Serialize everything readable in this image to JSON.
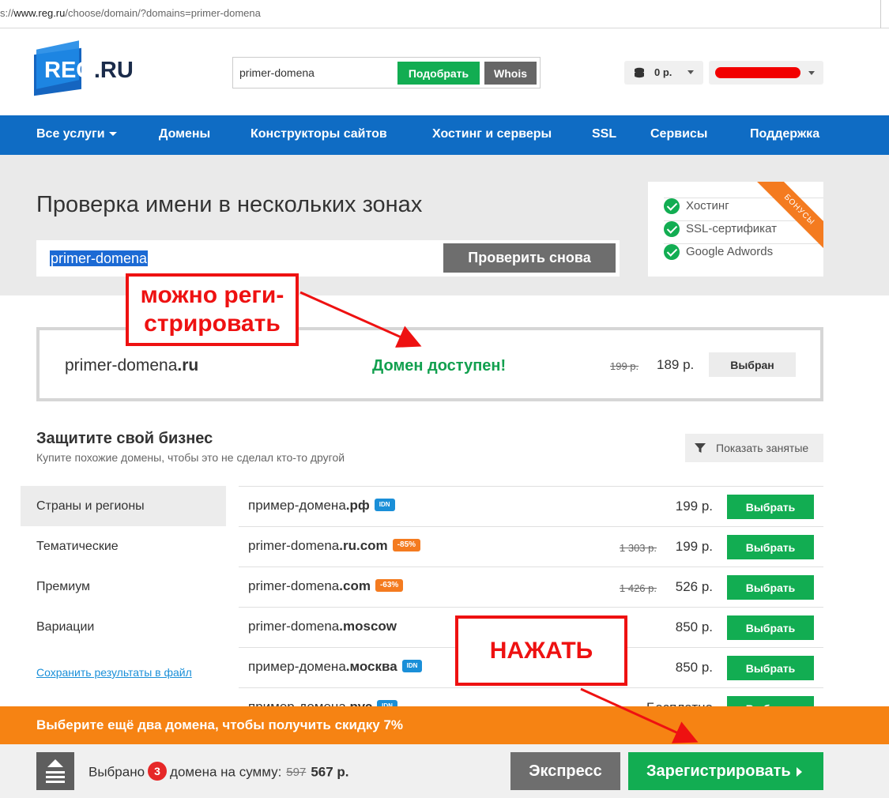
{
  "browser": {
    "url_prefix": "s://",
    "url_host": "www.reg.ru",
    "url_path": "/choose/domain/?domains=primer-domena"
  },
  "header": {
    "logo_text": "REG",
    "logo_dot": ".",
    "logo_ru": "RU",
    "search_value": "primer-domena",
    "pick_label": "Подобрать",
    "whois_label": "Whois",
    "balance": "0 р."
  },
  "nav": {
    "items": [
      "Все услуги",
      "Домены",
      "Конструкторы сайтов",
      "Хостинг и серверы",
      "SSL",
      "Сервисы",
      "Поддержка"
    ]
  },
  "hero": {
    "title": "Проверка имени в нескольких зонах",
    "query": "primer-domena",
    "recheck_label": "Проверить снова",
    "bonuses": [
      "Хостинг",
      "SSL-сертификат",
      "Google Adwords"
    ],
    "ribbon": "БОНУСЫ"
  },
  "annotations": {
    "register_line1": "можно реги-",
    "register_line2": "стрировать",
    "press": "НАЖАТЬ"
  },
  "result": {
    "name_prefix": "primer-domena",
    "name_zone": ".ru",
    "status": "Домен доступен!",
    "old_price": "199 р.",
    "price": "189 р.",
    "button": "Выбран"
  },
  "protect": {
    "title": "Защитите свой бизнес",
    "subtitle": "Купите похожие домены, чтобы это не сделал кто-то другой",
    "show_busy": "Показать занятые",
    "categories": [
      "Страны и регионы",
      "Тематические",
      "Премиум",
      "Вариации"
    ],
    "save_link": "Сохранить результаты в файл",
    "rows": [
      {
        "prefix": "пример-домена",
        "zone": ".рф",
        "tag": "IDN",
        "tag_type": "idn",
        "old": "",
        "price": "199 р.",
        "button": "Выбрать"
      },
      {
        "prefix": "primer-domena",
        "zone": ".ru.com",
        "tag": "-85%",
        "tag_type": "sale",
        "old": "1 303 р.",
        "price": "199 р.",
        "button": "Выбрать"
      },
      {
        "prefix": "primer-domena",
        "zone": ".com",
        "tag": "-63%",
        "tag_type": "sale",
        "old": "1 426 р.",
        "price": "526 р.",
        "button": "Выбрать"
      },
      {
        "prefix": "primer-domena",
        "zone": ".moscow",
        "tag": "",
        "tag_type": "",
        "old": "",
        "price": "850 р.",
        "button": "Выбрать"
      },
      {
        "prefix": "пример-домена",
        "zone": ".москва",
        "tag": "IDN",
        "tag_type": "idn",
        "old": "",
        "price": "850 р.",
        "button": "Выбрать"
      },
      {
        "prefix": "пример-домена",
        "zone": ".рус",
        "tag": "IDN",
        "tag_type": "idn",
        "old": "",
        "price": "Бесплатно",
        "button": "Выбрать"
      }
    ]
  },
  "footer": {
    "promo": "Выберите ещё два домена, чтобы получить скидку 7%",
    "selected_prefix": "Выбрано",
    "selected_count": "3",
    "selected_suffix": "домена на сумму:",
    "old_sum": "597",
    "sum": "567 р.",
    "express": "Экспресс",
    "register": "Зарегистрировать"
  },
  "colors": {
    "nav_blue": "#0f6cc4",
    "green": "#12ad52",
    "orange": "#f68313",
    "annotation_red": "#ee1111"
  }
}
